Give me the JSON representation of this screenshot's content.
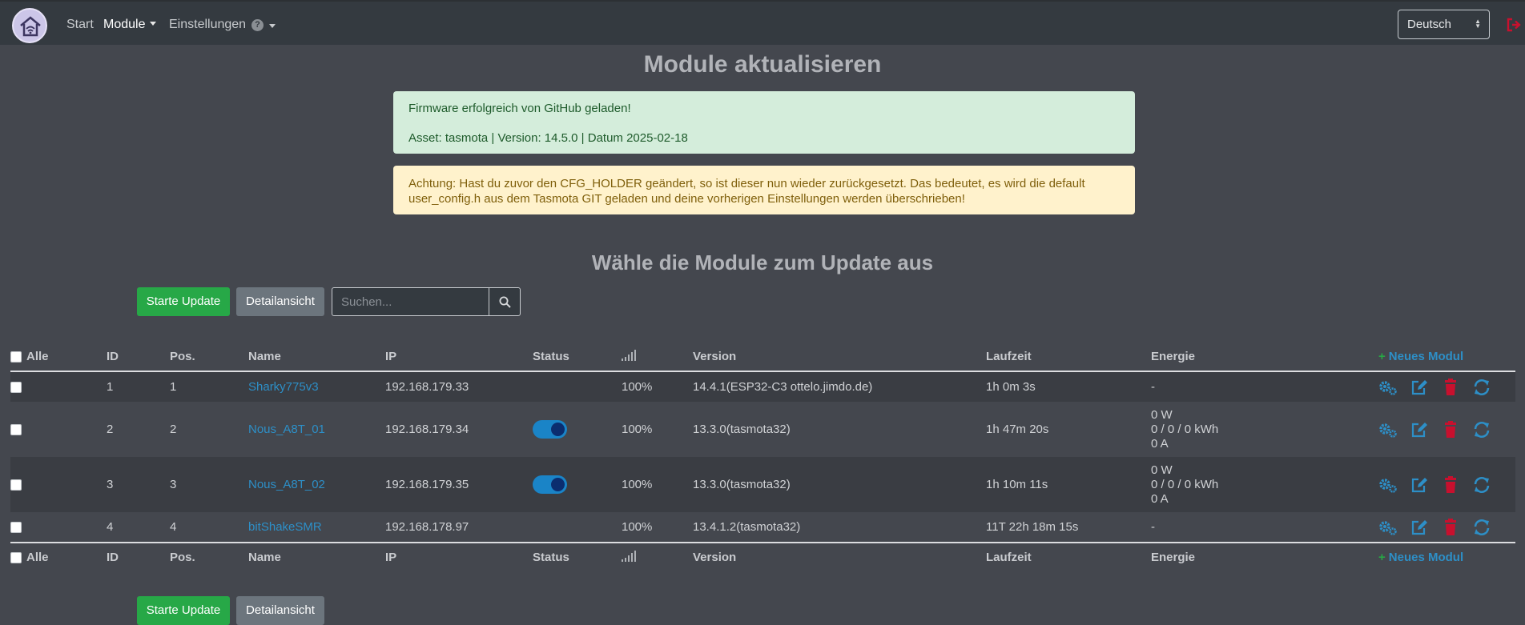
{
  "nav": {
    "items": [
      "Start",
      "Module",
      "Einstellungen"
    ],
    "language": "Deutsch"
  },
  "alerts": {
    "success_line1": "Firmware erfolgreich von GitHub geladen!",
    "success_line2": "Asset: tasmota | Version: 14.5.0 | Datum 2025-02-18",
    "warning": "Achtung: Hast du zuvor den CFG_HOLDER geändert, so ist dieser nun wieder zurückgesetzt. Das bedeutet, es wird die default user_config.h aus dem Tasmota GIT geladen und deine vorherigen Einstellungen werden überschrieben!"
  },
  "titles": {
    "page": "Module aktualisieren",
    "section": "Wähle die Module zum Update aus"
  },
  "buttons": {
    "start_update": "Starte Update",
    "detail_view": "Detailansicht"
  },
  "search": {
    "placeholder": "Suchen..."
  },
  "table": {
    "headers": {
      "all": "Alle",
      "id": "ID",
      "pos": "Pos.",
      "name": "Name",
      "ip": "IP",
      "status": "Status",
      "version": "Version",
      "uptime": "Laufzeit",
      "energy": "Energie",
      "new_module": "Neues Modul"
    },
    "rows": [
      {
        "id": "1",
        "pos": "1",
        "name": "Sharky775v3",
        "ip": "192.168.179.33",
        "signal": "100%",
        "version": "14.4.1(ESP32-C3 ottelo.jimdo.de)",
        "uptime": "1h 0m 3s",
        "energy": [
          "-"
        ]
      },
      {
        "id": "2",
        "pos": "2",
        "name": "Nous_A8T_01",
        "ip": "192.168.179.34",
        "signal": "100%",
        "version": "13.3.0(tasmota32)",
        "uptime": "1h 47m 20s",
        "energy": [
          "0 W",
          "0 / 0 / 0 kWh",
          "0 A"
        ],
        "power_on": true
      },
      {
        "id": "3",
        "pos": "3",
        "name": "Nous_A8T_02",
        "ip": "192.168.179.35",
        "signal": "100%",
        "version": "13.3.0(tasmota32)",
        "uptime": "1h 10m 11s",
        "energy": [
          "0 W",
          "0 / 0 / 0 kWh",
          "0 A"
        ],
        "power_on": true
      },
      {
        "id": "4",
        "pos": "4",
        "name": "bitShakeSMR",
        "ip": "192.168.178.97",
        "signal": "100%",
        "version": "13.4.1.2(tasmota32)",
        "uptime": "11T 22h 18m 15s",
        "energy": [
          "-"
        ]
      }
    ]
  },
  "icons": [
    "home-logo-icon",
    "help-icon",
    "logout-icon",
    "search-icon",
    "signal-icon",
    "gears-icon",
    "edit-icon",
    "trash-icon",
    "refresh-icon",
    "plus-icon"
  ],
  "colors": {
    "background": "#44474e",
    "navbar": "#343a40",
    "success": "#27a847",
    "link": "#2d8fc7",
    "danger": "#c8102e"
  }
}
